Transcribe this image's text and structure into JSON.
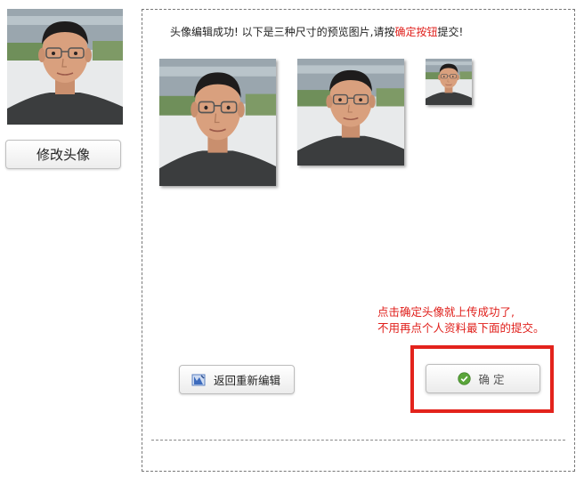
{
  "sidebar": {
    "modify_avatar_label": "修改头像"
  },
  "main": {
    "message_before": "头像编辑成功! 以下是三种尺寸的预览图片,请按",
    "message_highlight": "确定按钮",
    "message_after": "提交!",
    "note_line1": "点击确定头像就上传成功了,",
    "note_line2": "不用再点个人资料最下面的提交。",
    "back_button_label": "返回重新编辑",
    "confirm_button_label": "确定"
  },
  "icons": {
    "back": "back-edit-icon",
    "confirm": "check-circle-icon"
  },
  "colors": {
    "highlight_red": "#e0201c",
    "frame_red": "#e3231c",
    "check_green": "#5aa53a"
  }
}
